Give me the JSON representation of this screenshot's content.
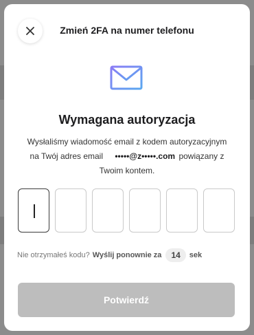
{
  "modal": {
    "title": "Zmień 2FA na numer telefonu",
    "close_icon": "close-icon",
    "mail_icon": "envelope-icon",
    "heading": "Wymagana autoryzacja",
    "desc_line1": "Wysłaliśmy wiadomość email z kodem autoryzacyjnym",
    "desc_line2_prefix": "na Twój adres email",
    "email_masked": "•••••@z•••••.com",
    "desc_line2_suffix": "powiązany z",
    "desc_line3": "Twoim kontem.",
    "code_length": 6,
    "code_values": [
      "",
      "",
      "",
      "",
      "",
      ""
    ],
    "resend_prompt": "Nie otrzymałeś kodu?",
    "resend_action": "Wyślij ponownie za",
    "resend_seconds": "14",
    "resend_unit": "sek",
    "confirm_label": "Potwierdź",
    "confirm_disabled": true
  },
  "colors": {
    "accent_icon": "#7b6cf0",
    "button_disabled": "#bdbdbd",
    "overlay": "#8c8c8c"
  }
}
